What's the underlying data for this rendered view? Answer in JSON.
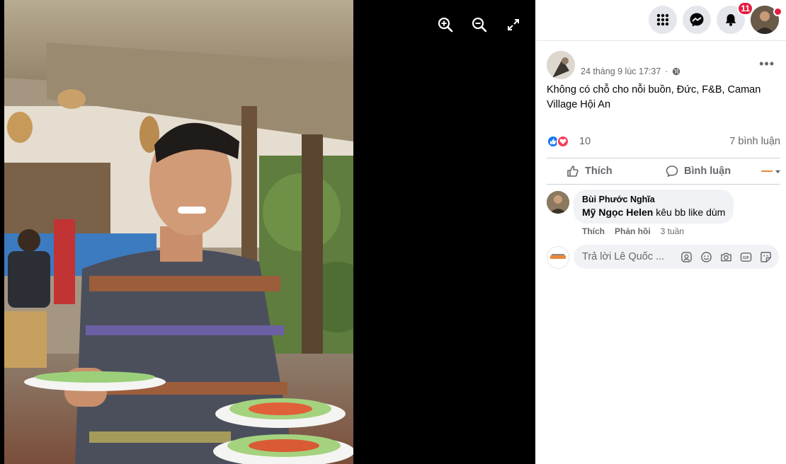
{
  "viewer": {
    "tools": [
      {
        "name": "zoom-in-icon"
      },
      {
        "name": "zoom-out-icon"
      },
      {
        "name": "fullscreen-icon"
      }
    ]
  },
  "topbar": {
    "notifications_count": "11"
  },
  "post": {
    "timestamp": "24 tháng 9 lúc 17:37",
    "privacy_icon": "globe-icon",
    "more_label": "•••",
    "caption": "Không có chỗ cho nỗi buồn, Đức, F&B, Caman Village Hội An",
    "reactions": {
      "count": "10",
      "types": [
        "like-icon",
        "love-icon"
      ],
      "like_color": "#1877f2",
      "love_color": "#f33e58"
    },
    "comments_count": "7 bình luận",
    "actions": {
      "like": "Thích",
      "comment": "Bình luận"
    }
  },
  "comment": {
    "author": "Bùi Phước Nghĩa",
    "tag": "Mỹ Ngọc Helen",
    "text": " kêu bb like dùm",
    "like_link": "Thích",
    "reply_link": "Phản hồi",
    "time": "3 tuần"
  },
  "reply_box": {
    "placeholder": "Trả lời Lê Quốc ..."
  },
  "colors": {
    "accent": "#1877f2",
    "badge": "#e41e3f",
    "muted": "#65676b"
  }
}
